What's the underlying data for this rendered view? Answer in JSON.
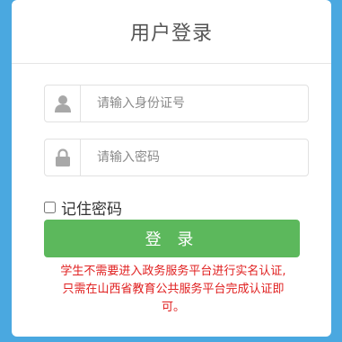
{
  "login": {
    "title": "用户登录",
    "username_placeholder": "请输入身份证号",
    "password_placeholder": "请输入密码",
    "remember_label": "记住密码",
    "submit_label": "登 录",
    "notice_line1": "学生不需要进入政务服务平台进行实名认证,",
    "notice_line2": "只需在山西省教育公共服务平台完成认证即",
    "notice_line3": "可。",
    "icons": {
      "username": "user-icon",
      "password": "lock-icon"
    },
    "colors": {
      "background": "#4aa8e0",
      "button": "#5cb85c",
      "notice": "#e02020",
      "icon": "#a8a8a8"
    }
  }
}
